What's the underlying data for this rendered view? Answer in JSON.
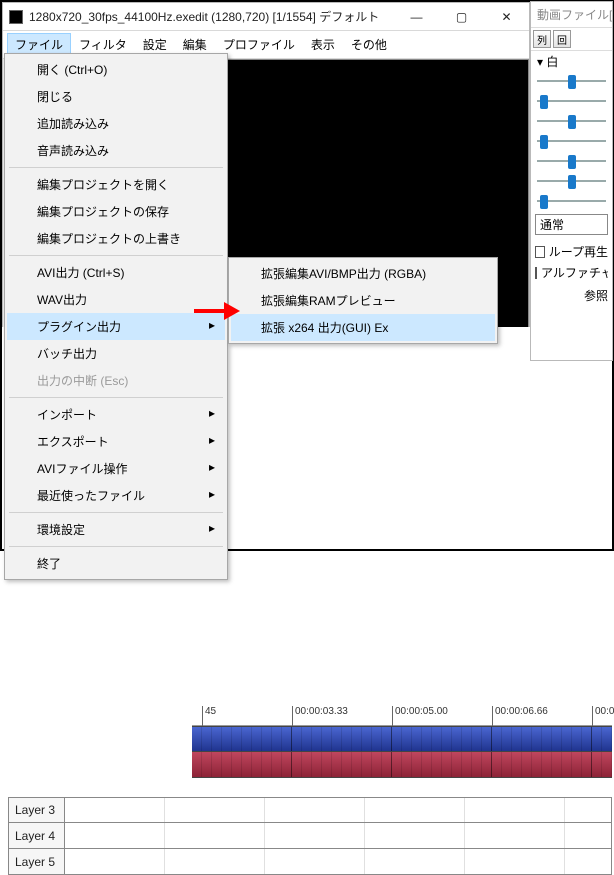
{
  "window": {
    "title": "1280x720_30fps_44100Hz.exedit (1280,720) [1/1554] デフォルト"
  },
  "menubar": [
    "ファイル",
    "フィルタ",
    "設定",
    "編集",
    "プロファイル",
    "表示",
    "その他"
  ],
  "file_menu": {
    "open": "開く (Ctrl+O)",
    "close": "閉じる",
    "add_load": "追加読み込み",
    "audio_load": "音声読み込み",
    "proj_open": "編集プロジェクトを開く",
    "proj_save": "編集プロジェクトの保存",
    "proj_overwrite": "編集プロジェクトの上書き",
    "avi_out": "AVI出力 (Ctrl+S)",
    "wav_out": "WAV出力",
    "plugin_out": "プラグイン出力",
    "batch_out": "バッチ出力",
    "abort_out": "出力の中断 (Esc)",
    "import": "インポート",
    "export": "エクスポート",
    "avi_ops": "AVIファイル操作",
    "recent": "最近使ったファイル",
    "prefs": "環境設定",
    "exit": "終了"
  },
  "plugin_submenu": {
    "rgba": "拡張編集AVI/BMP出力 (RGBA)",
    "ram": "拡張編集RAMプレビュー",
    "x264": "拡張 x264 出力(GUI) Ex"
  },
  "timeline": {
    "ticks": [
      "45",
      "00:00:03.33",
      "00:00:05.00",
      "00:00:06.66",
      "00:00:0"
    ],
    "layers": [
      "Layer 3",
      "Layer 4",
      "Layer 5"
    ]
  },
  "sidewin": {
    "title": "動画ファイル[標",
    "tree_root": "白",
    "mode": "通常",
    "cb_loop": "ループ再生",
    "cb_alpha": "アルファチャ",
    "ref": "参照"
  }
}
